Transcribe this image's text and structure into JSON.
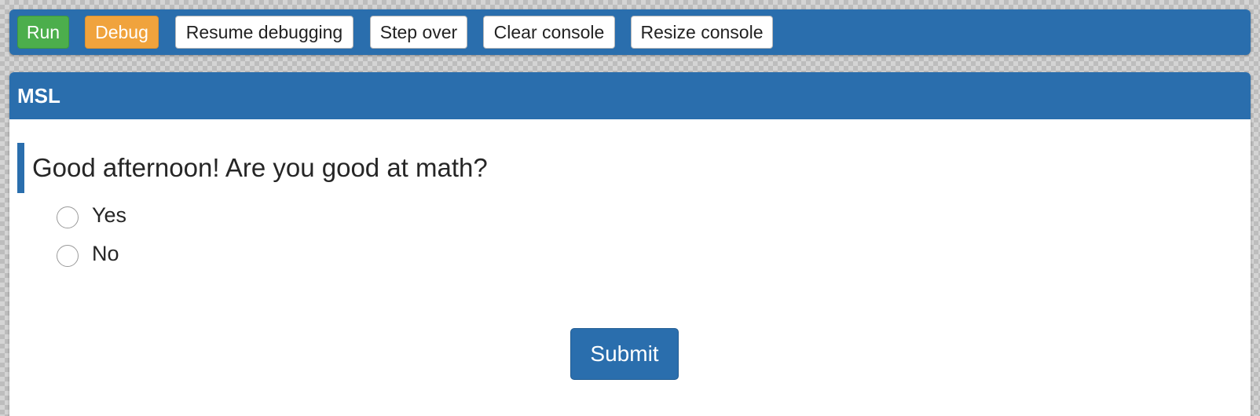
{
  "toolbar": {
    "run_label": "Run",
    "debug_label": "Debug",
    "resume_label": "Resume debugging",
    "step_over_label": "Step over",
    "clear_console_label": "Clear console",
    "resize_console_label": "Resize console"
  },
  "panel": {
    "title": "MSL"
  },
  "survey": {
    "question": "Good afternoon! Are you good at math?",
    "options": [
      {
        "label": "Yes",
        "selected": false
      },
      {
        "label": "No",
        "selected": false
      }
    ],
    "submit_label": "Submit"
  },
  "colors": {
    "accent": "#2a6ead",
    "run": "#4cae4c",
    "debug": "#f0a33d"
  }
}
